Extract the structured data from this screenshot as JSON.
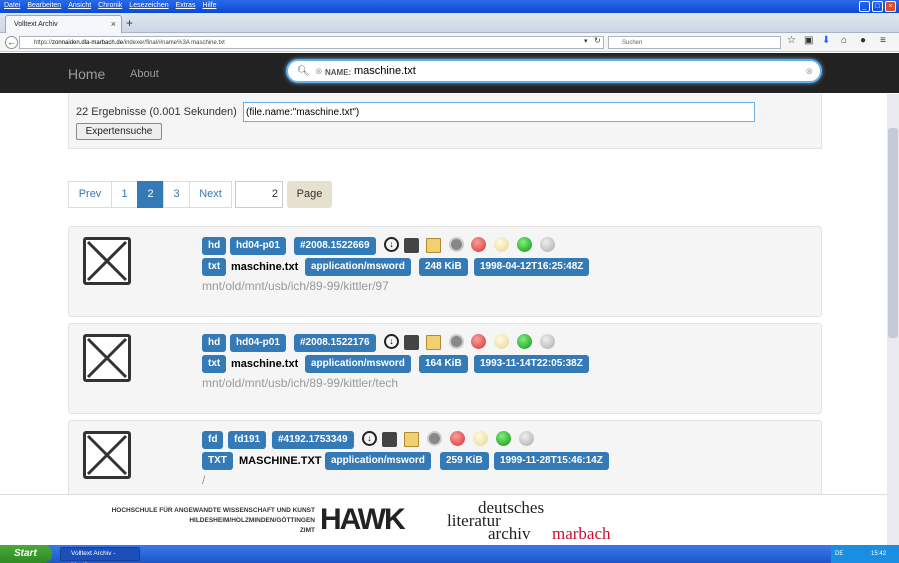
{
  "browser": {
    "menu": [
      "Datei",
      "Bearbeiten",
      "Ansicht",
      "Chronik",
      "Lesezeichen",
      "Extras",
      "Hilfe"
    ],
    "tab_title": "Volltext Archiv",
    "url_prefix": "https://",
    "url_host": "zonnaiden.dla-marbach.de",
    "url_path": "/indexer/final/#name%3A maschine.txt",
    "search_placeholder": "Suchen"
  },
  "appnav": {
    "home": "Home",
    "about": "About"
  },
  "search": {
    "chip_label": "NAME:",
    "value": "maschine.txt"
  },
  "results": {
    "count_text": "22 Ergebnisse (0.001 Sekunden)",
    "query": "(file.name:\"maschine.txt\")",
    "expert_label": "Expertensuche"
  },
  "pagination": {
    "prev": "Prev",
    "pages": [
      "1",
      "2",
      "3"
    ],
    "active": "2",
    "next": "Next",
    "page_input": "2",
    "page_button": "Page"
  },
  "items": [
    {
      "medium": "hd",
      "volume": "hd04-p01",
      "id": "#2008.1522669",
      "ext": "txt",
      "name": "maschine.txt",
      "mime": "application/msword",
      "size": "248 KiB",
      "date": "1998-04-12T16:25:48Z",
      "path": "mnt/old/mnt/usb/ich/89-99/kittler/97"
    },
    {
      "medium": "hd",
      "volume": "hd04-p01",
      "id": "#2008.1522176",
      "ext": "txt",
      "name": "maschine.txt",
      "mime": "application/msword",
      "size": "164 KiB",
      "date": "1993-11-14T22:05:38Z",
      "path": "mnt/old/mnt/usb/ich/89-99/kittler/tech"
    },
    {
      "medium": "fd",
      "volume": "fd191",
      "id": "#4192.1753349",
      "ext": "TXT",
      "name": "MASCHINE.TXT",
      "mime": "application/msword",
      "size": "259 KiB",
      "date": "1999-11-28T15:46:14Z",
      "path": "/"
    }
  ],
  "footer": {
    "hawk_line1": "HOCHSCHULE FÜR ANGEWANDTE WISSENSCHAFT UND KUNST",
    "hawk_line2": "HILDESHEIM/HOLZMINDEN/GÖTTINGEN",
    "hawk_line3": "ZIMT",
    "hawk_logo": "HAWK",
    "dla_1": "deutsches",
    "dla_2": "literatur",
    "dla_3": "archiv",
    "dla_4": "marbach"
  },
  "taskbar": {
    "start": "Start",
    "task": "Volltext Archiv - Mozill...",
    "lang": "DE",
    "clock": "15:42"
  },
  "colors": {
    "badge": "#337ab7",
    "nav": "#222222",
    "red": "#d9302c",
    "green": "#22b322",
    "hawk_accent": "#c8102e"
  },
  "icons": [
    "download-icon",
    "unlock-icon",
    "edit-icon",
    "disk-icon",
    "red-status-icon",
    "yellow-status-icon",
    "green-status-icon",
    "gray-status-icon"
  ]
}
